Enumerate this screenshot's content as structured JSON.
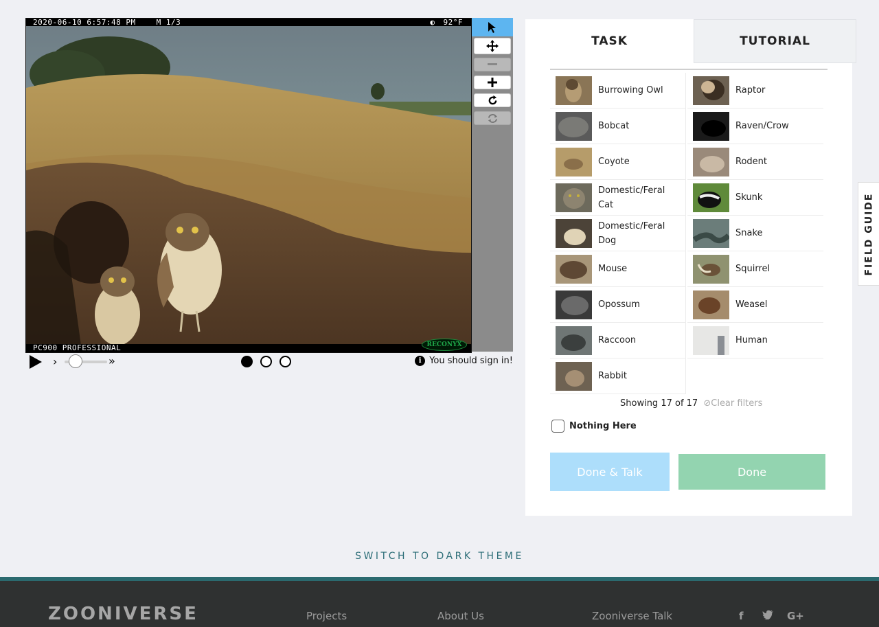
{
  "camera": {
    "datetime": "2020-06-10 6:57:48 PM",
    "frame_marker": "M 1/3",
    "moon": "◐",
    "temperature": "92°F",
    "model": "PC900 PROFESSIONAL",
    "brand": "RECONYX"
  },
  "toolbar": {
    "pointer_icon": "arrow-pointer",
    "pan_icon": "four-way-arrows",
    "zoom_out_icon": "minus",
    "zoom_in_icon": "plus",
    "rotate_icon": "rotate-clockwise",
    "reset_icon": "refresh"
  },
  "controls": {
    "signin_text": "You should sign in!",
    "frame_count": 3,
    "current_frame": 1
  },
  "tabs": {
    "task": "TASK",
    "tutorial": "TUTORIAL"
  },
  "choices": [
    {
      "label": "Burrowing Owl"
    },
    {
      "label": "Raptor"
    },
    {
      "label": "Bobcat"
    },
    {
      "label": "Raven/Crow"
    },
    {
      "label": "Coyote"
    },
    {
      "label": "Rodent"
    },
    {
      "label": "Domestic/Feral Cat"
    },
    {
      "label": "Skunk"
    },
    {
      "label": "Domestic/Feral Dog"
    },
    {
      "label": "Snake"
    },
    {
      "label": "Mouse"
    },
    {
      "label": "Squirrel"
    },
    {
      "label": "Opossum"
    },
    {
      "label": "Weasel"
    },
    {
      "label": "Raccoon"
    },
    {
      "label": "Human"
    },
    {
      "label": "Rabbit"
    }
  ],
  "filter": {
    "showing": "Showing 17 of 17",
    "clear": "Clear filters"
  },
  "nothing_here": "Nothing Here",
  "buttons": {
    "done_talk": "Done & Talk",
    "done": "Done"
  },
  "field_guide": "FIELD GUIDE",
  "theme_toggle": "SWITCH TO DARK THEME",
  "footer": {
    "logo": "ZOONIVERSE",
    "links": {
      "projects": "Projects",
      "about": "About Us",
      "talk": "Zooniverse Talk"
    },
    "social": {
      "facebook": "f",
      "twitter": "t",
      "google": "G+"
    }
  },
  "colors": {
    "accent_blue": "#5db5f0",
    "done_green": "#93d4b0",
    "talk_blue": "#addefb",
    "footer_bg": "#2f3131",
    "footer_rule": "#2b6a6f"
  }
}
